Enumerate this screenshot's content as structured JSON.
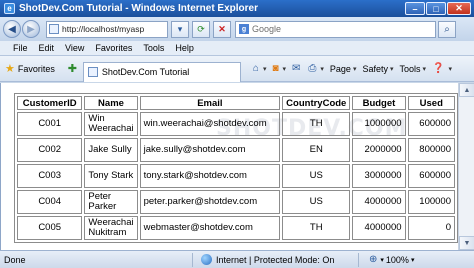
{
  "window": {
    "title": "ShotDev.Com Tutorial - Windows Internet Explorer"
  },
  "address": {
    "url": "http://localhost/myasp",
    "search_placeholder": "Google"
  },
  "menu": [
    "File",
    "Edit",
    "View",
    "Favorites",
    "Tools",
    "Help"
  ],
  "favorites_bar": {
    "favorites_label": "Favorites",
    "tab_title": "ShotDev.Com Tutorial",
    "commands": {
      "page": "Page",
      "safety": "Safety",
      "tools": "Tools"
    }
  },
  "table": {
    "headers": [
      "CustomerID",
      "Name",
      "Email",
      "CountryCode",
      "Budget",
      "Used"
    ],
    "rows": [
      [
        "C001",
        "Win Weerachai",
        "win.weerachai@shotdev.com",
        "TH",
        "1000000",
        "600000"
      ],
      [
        "C002",
        "Jake Sully",
        "jake.sully@shotdev.com",
        "EN",
        "2000000",
        "800000"
      ],
      [
        "C003",
        "Tony Stark",
        "tony.stark@shotdev.com",
        "US",
        "3000000",
        "600000"
      ],
      [
        "C004",
        "Peter Parker",
        "peter.parker@shotdev.com",
        "US",
        "4000000",
        "100000"
      ],
      [
        "C005",
        "Weerachai Nukitram",
        "webmaster@shotdev.com",
        "TH",
        "4000000",
        "0"
      ]
    ]
  },
  "watermark": "SHOTDEV.COM",
  "status": {
    "left": "Done",
    "zone": "Internet | Protected Mode: On",
    "zoom": "100%"
  }
}
